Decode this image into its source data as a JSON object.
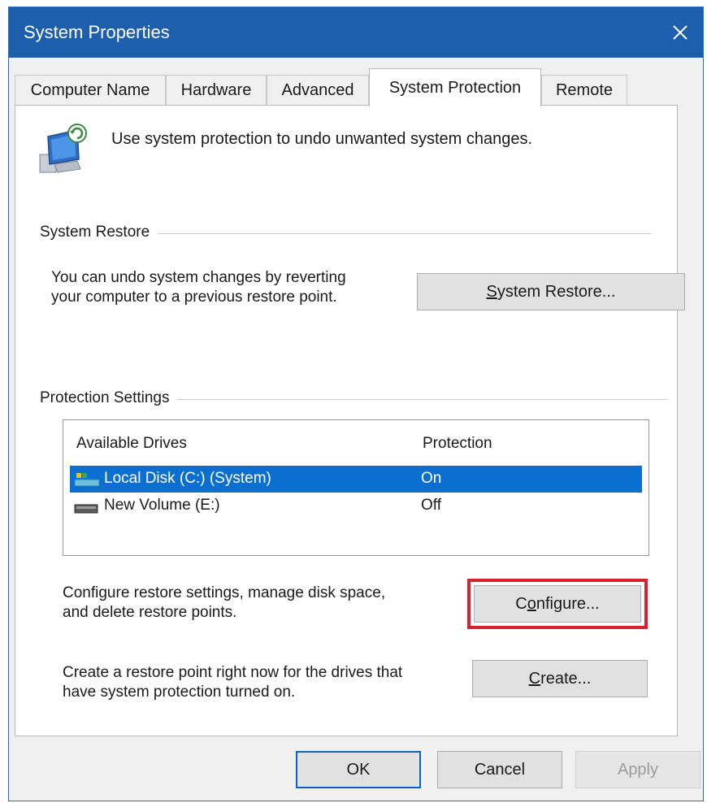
{
  "window": {
    "title": "System Properties"
  },
  "tabs": [
    {
      "label": "Computer Name",
      "active": false
    },
    {
      "label": "Hardware",
      "active": false
    },
    {
      "label": "Advanced",
      "active": false
    },
    {
      "label": "System Protection",
      "active": true
    },
    {
      "label": "Remote",
      "active": false
    }
  ],
  "intro": {
    "text": "Use system protection to undo unwanted system changes.",
    "icon": "system-protection-icon"
  },
  "system_restore": {
    "group_label": "System Restore",
    "description_line1": "You can undo system changes by reverting",
    "description_line2": "your computer to a previous restore point.",
    "button_underlined": "S",
    "button_rest": "ystem Restore..."
  },
  "protection_settings": {
    "group_label": "Protection Settings",
    "columns": [
      "Available Drives",
      "Protection"
    ],
    "drives": [
      {
        "name": "Local Disk (C:) (System)",
        "protection": "On",
        "selected": true,
        "icon": "system-drive-icon"
      },
      {
        "name": "New Volume (E:)",
        "protection": "Off",
        "selected": false,
        "icon": "drive-icon"
      }
    ],
    "configure_description_line1": "Configure restore settings, manage disk space,",
    "configure_description_line2": "and delete restore points.",
    "configure_button_pre": "C",
    "configure_button_underlined": "o",
    "configure_button_rest": "nfigure...",
    "create_description_line1": "Create a restore point right now for the drives that",
    "create_description_line2": "have system protection turned on.",
    "create_button_underlined": "C",
    "create_button_rest": "reate..."
  },
  "footer": {
    "ok_label": "OK",
    "cancel_label": "Cancel",
    "apply_underlined": "A",
    "apply_rest": "pply"
  },
  "colors": {
    "titlebar": "#1d5fad",
    "selection": "#0a6fd0",
    "highlight": "#d6222e"
  }
}
